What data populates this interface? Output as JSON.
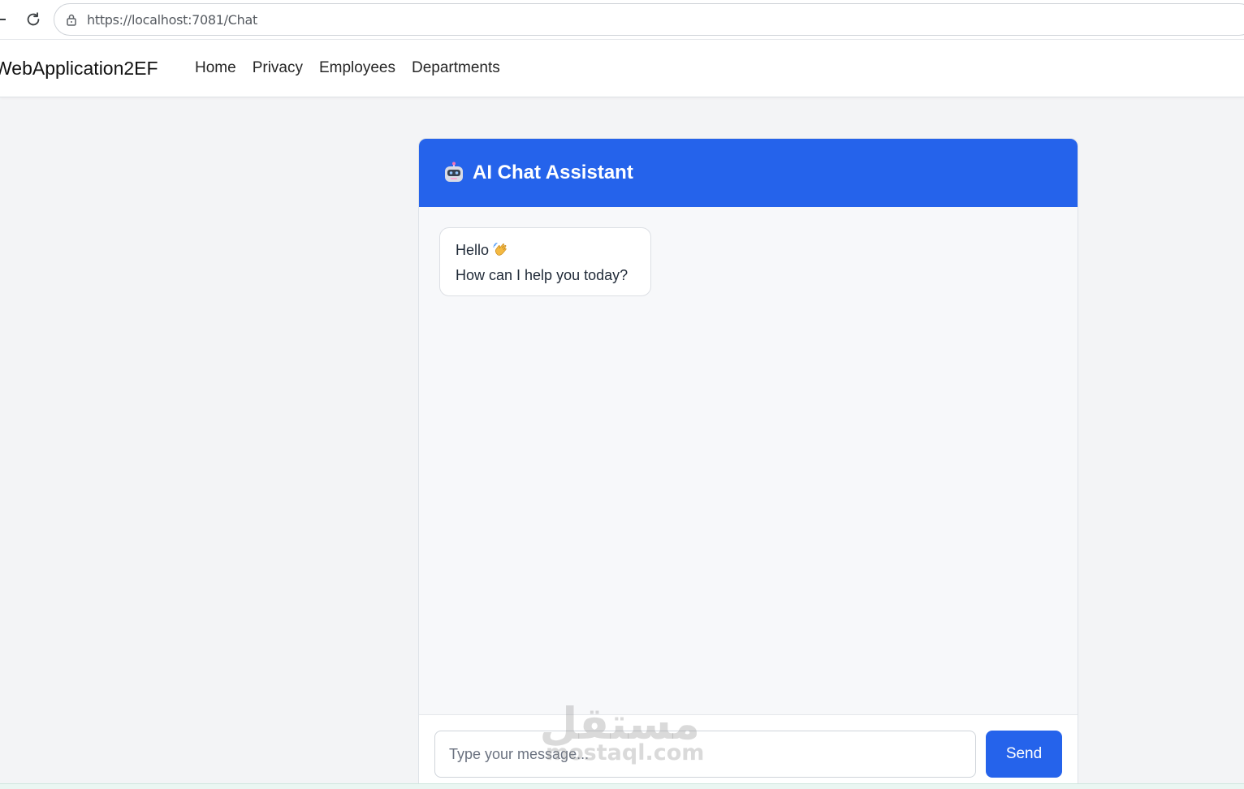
{
  "browser": {
    "url": "https://localhost:7081/Chat"
  },
  "navbar": {
    "brand": "WebApplication2EF",
    "links": [
      "Home",
      "Privacy",
      "Employees",
      "Departments"
    ]
  },
  "chat": {
    "title": "AI Chat Assistant",
    "title_icon": "robot-icon",
    "messages": [
      {
        "line1": "Hello",
        "line1_icon": "waving-hand-icon",
        "line2": "How can I help you today?"
      }
    ],
    "input_placeholder": "Type your message...",
    "send_label": "Send"
  },
  "watermark": {
    "logo": "مستقل",
    "domain": "mostaql.com"
  },
  "colors": {
    "accent": "#2563eb",
    "page_background": "#f3f4f6",
    "chat_background": "#f7f8fa"
  }
}
